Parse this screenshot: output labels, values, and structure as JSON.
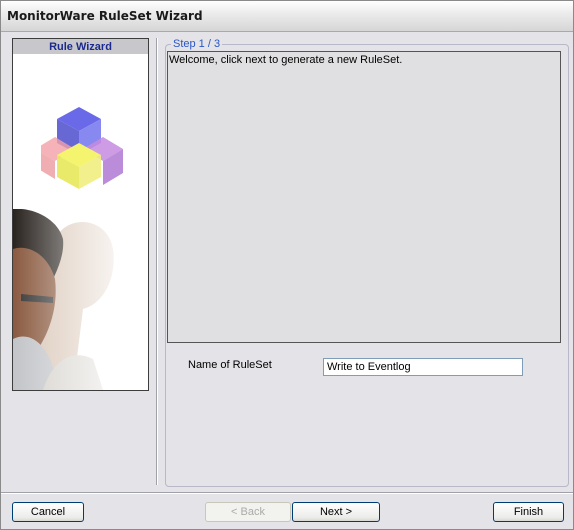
{
  "window": {
    "title": "MonitorWare RuleSet Wizard"
  },
  "sidebar": {
    "header": "Rule Wizard"
  },
  "step": {
    "legend": "Step 1 / 3",
    "message": "Welcome, click next to generate a new RuleSet."
  },
  "form": {
    "name_label": "Name of RuleSet",
    "name_value": "Write to Eventlog"
  },
  "buttons": {
    "cancel": "Cancel",
    "back": "< Back",
    "next": "Next >",
    "finish": "Finish"
  }
}
